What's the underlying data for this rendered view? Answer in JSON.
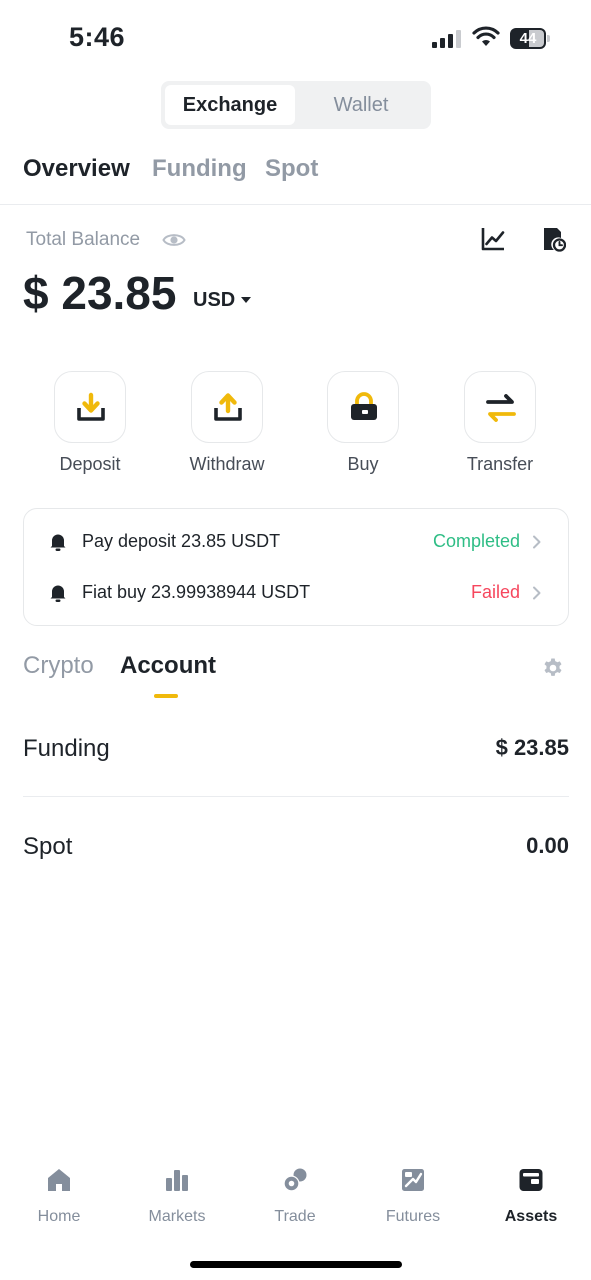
{
  "status_bar": {
    "time": "5:46",
    "battery": "44"
  },
  "segmented": {
    "exchange": "Exchange",
    "wallet": "Wallet"
  },
  "top_tabs": [
    "Overview",
    "Funding",
    "Spot"
  ],
  "balance": {
    "label": "Total Balance",
    "amount": "$ 23.85",
    "currency": "USD"
  },
  "actions": [
    "Deposit",
    "Withdraw",
    "Buy",
    "Transfer"
  ],
  "notices": [
    {
      "text": "Pay deposit 23.85 USDT",
      "status": "Completed",
      "status_color": "#2ebd85"
    },
    {
      "text": "Fiat buy 23.99938944 USDT",
      "status": "Failed",
      "status_color": "#f6465d"
    }
  ],
  "sub_tabs": {
    "crypto": "Crypto",
    "account": "Account"
  },
  "accounts": [
    {
      "name": "Funding",
      "value": "$ 23.85"
    },
    {
      "name": "Spot",
      "value": "0.00"
    }
  ],
  "bottom_nav": [
    "Home",
    "Markets",
    "Trade",
    "Futures",
    "Assets"
  ],
  "colors": {
    "accent": "#f0b90b",
    "text": "#1e2329",
    "muted": "#929aa5"
  },
  "icons": {
    "status": [
      "signal-icon",
      "wifi-icon",
      "battery-icon"
    ],
    "balance": [
      "eye-icon",
      "chart-icon",
      "history-icon"
    ],
    "actions": [
      "deposit-icon",
      "withdraw-icon",
      "buy-icon",
      "transfer-icon"
    ],
    "nav": [
      "home-icon",
      "markets-icon",
      "trade-icon",
      "futures-icon",
      "assets-icon"
    ]
  }
}
